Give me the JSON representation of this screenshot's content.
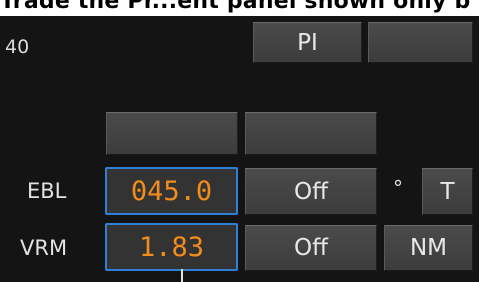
{
  "banner": {
    "text": "Trade the Pr...ent panel shown only b"
  },
  "range": {
    "value": "40"
  },
  "buttons": {
    "pi": "PI",
    "blank_top": "",
    "blank_left": "",
    "blank_mid": ""
  },
  "ebl": {
    "label": "EBL",
    "value": "045.0",
    "off_label": "Off",
    "degree_symbol": "°",
    "reference_label": "T"
  },
  "vrm": {
    "label": "VRM",
    "value": "1.83",
    "off_label": "Off",
    "unit_label": "NM"
  },
  "colors": {
    "panel_bg": "#141414",
    "button_bg": "#454545",
    "field_border": "#2f7fd6",
    "field_text": "#f28c1c",
    "label_text": "#e2e2e2"
  }
}
